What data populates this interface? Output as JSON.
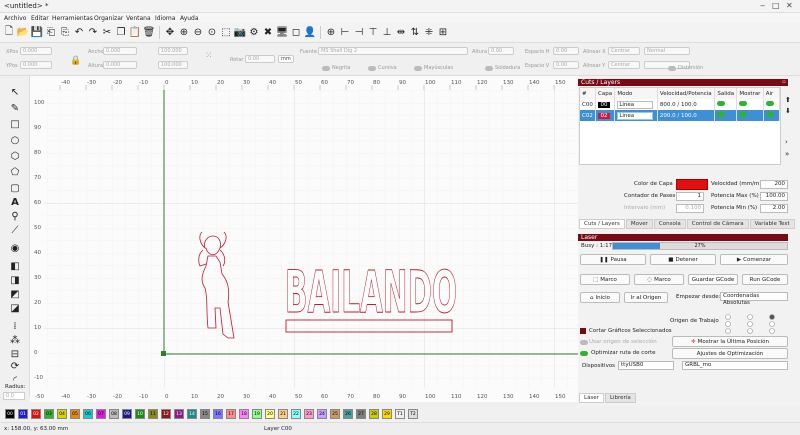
{
  "window": {
    "title": "<untitled> *"
  },
  "menu": [
    "Archivo",
    "Editar",
    "Herramientas",
    "Organizar",
    "Ventana",
    "Idioma",
    "Ayuda"
  ],
  "propbar": {
    "xpos_label": "XPos",
    "xpos_value": "0.000",
    "ypos_label": "YPos",
    "ypos_value": "0.000",
    "width_label": "Ancho",
    "width_value": "0.000",
    "height_label": "Altura",
    "height_value": "0.000",
    "angle_label": "Rotar",
    "angle_value": "0.00",
    "unit": "mm",
    "font_label": "Fuente",
    "font_value": "MS Shell Dlg 2",
    "font_height_label": "Altura",
    "font_height_value": "0.00",
    "hspace_label": "Espacio H",
    "hspace_value": "0.00",
    "align_h_label": "Alinear X",
    "align_h_value": "Centrar",
    "vspace_label": "Espacio V",
    "vspace_value": "0.00",
    "align_v_label": "Alinear Y",
    "align_v_value": "Centrar",
    "opt_negrita": "Negrita",
    "opt_cursiva": "Cursiva",
    "opt_mayus": "Mayúsculas",
    "opt_soldadura": "Soldadura",
    "opt_distorsion": "Distorsión"
  },
  "rulers": {
    "top": [
      "-50",
      "-40",
      "-30",
      "-20",
      "-10",
      "0",
      "10",
      "20",
      "30",
      "40",
      "50",
      "60",
      "70",
      "80",
      "90",
      "100",
      "110",
      "120",
      "130",
      "140",
      "150",
      "160"
    ],
    "left": [
      "100",
      "90",
      "80",
      "70",
      "60",
      "50",
      "40",
      "30",
      "20",
      "10",
      "0",
      "-10"
    ]
  },
  "canvas": {
    "label": "BAILANDO"
  },
  "cuts_panel": {
    "title": "Cuts / Layers",
    "columns": [
      "#",
      "Capa",
      "Modo",
      "Velocidad/Potencia",
      "Salida",
      "Mostrar",
      "Air"
    ],
    "rows": [
      {
        "num": "C00",
        "layer": "00",
        "mode": "Linea",
        "speed": "800.0 / 100.0",
        "color": "#000000",
        "selected": false
      },
      {
        "num": "C02",
        "layer": "02",
        "mode": "Linea",
        "speed": "200.0 / 100.0",
        "color": "#d41a3a",
        "selected": true
      }
    ],
    "layer_color_label": "Color de Capa",
    "layer_color": "#e01010",
    "speed_label": "Velocidad (mm/m)",
    "speed_value": "200",
    "passes_label": "Contador de Pases",
    "passes_value": "1",
    "power_max_label": "Potencia Max (%)",
    "power_max_value": "100.00",
    "interval_label": "Intervalo (mm)",
    "interval_value": "0.100",
    "power_min_label": "Potencia Min (%)",
    "power_min_value": "2.00",
    "tabs": [
      "Cuts / Layers",
      "Mover",
      "Consola",
      "Control de Cámara",
      "Variable Text"
    ]
  },
  "laser_panel": {
    "title": "Laser",
    "status": "Busy : 1:17",
    "progress_text": "27%",
    "progress": 0.27,
    "pause": "Pausa",
    "stop": "Detener",
    "start": "Comenzar",
    "frame1": "Marco",
    "frame2": "Marco",
    "save_gcode": "Guardar GCode",
    "run_gcode": "Run GCode",
    "home": "Inicio",
    "goto_origin": "Ir al Origen",
    "start_from_label": "Empezar desde:",
    "start_from_value": "Coordenadas Absolutas",
    "job_origin_label": "Origen de Trabajo",
    "cut_selected": "Cortar Gráficos Seleccionados",
    "use_selection_origin": "Usar origen de selección",
    "show_last_position": "Mostrar la Última Posición",
    "optimize_route": "Optimizar ruta de corte",
    "optimization_settings": "Ajustes de Optimización",
    "devices_label": "Dispositivos",
    "port_value": "ttyUSB0",
    "device_value": "GRBL_mo",
    "tabs": [
      "Láser",
      "Librería"
    ]
  },
  "palette": [
    "00",
    "01",
    "02",
    "03",
    "04",
    "05",
    "06",
    "07",
    "08",
    "09",
    "10",
    "11",
    "12",
    "13",
    "14",
    "15",
    "16",
    "17",
    "18",
    "19",
    "20",
    "21",
    "22",
    "23",
    "24",
    "25",
    "26",
    "27",
    "28",
    "29",
    "T1",
    "T2"
  ],
  "palette_colors": [
    "#000000",
    "#1b1bd6",
    "#e01010",
    "#2fb52f",
    "#d4d400",
    "#e08a10",
    "#17c9c9",
    "#e217e2",
    "#bbbbbb",
    "#1b1b8a",
    "#1b8a1b",
    "#8a8a1b",
    "#8a1b1b",
    "#8a1b8a",
    "#1b8a8a",
    "#888888",
    "#7a7aff",
    "#ff8c8c",
    "#ff7fff",
    "#8cff8c",
    "#ffff8c",
    "#ffc88c",
    "#8cffff",
    "#ff99cc",
    "#c8a0ff",
    "#c89a6a",
    "#4aa0a0",
    "#7f7f7f",
    "#cccc00",
    "#ffd700",
    "#eeeeee",
    "#dddddd"
  ],
  "status": {
    "coords": "x: 158.00, y: 63.00 mm",
    "layer": "Layer C00"
  },
  "left_label": "Radius:",
  "left_value": "0.0"
}
